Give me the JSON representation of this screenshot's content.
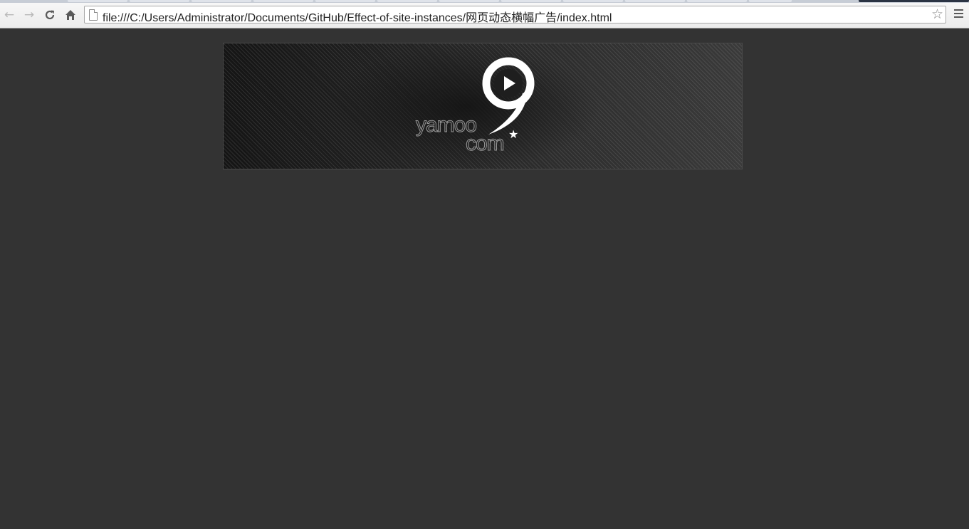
{
  "browser": {
    "url": "file:///C:/Users/Administrator/Documents/GitHub/Effect-of-site-instances/网页动态横幅广告/index.html",
    "icons": {
      "back": "back-arrow-icon",
      "forward": "forward-arrow-icon",
      "reload": "reload-icon",
      "home": "home-icon",
      "page": "page-icon",
      "bookmark": "star-icon",
      "menu": "hamburger-menu-icon"
    }
  },
  "banner": {
    "logo_line1": "yamoo",
    "logo_line2": "com",
    "icons": {
      "logo": "nine-play-logo-icon",
      "star": "star-icon"
    }
  },
  "colors": {
    "page_background": "#333333",
    "banner_background": "#1e1e1e"
  }
}
